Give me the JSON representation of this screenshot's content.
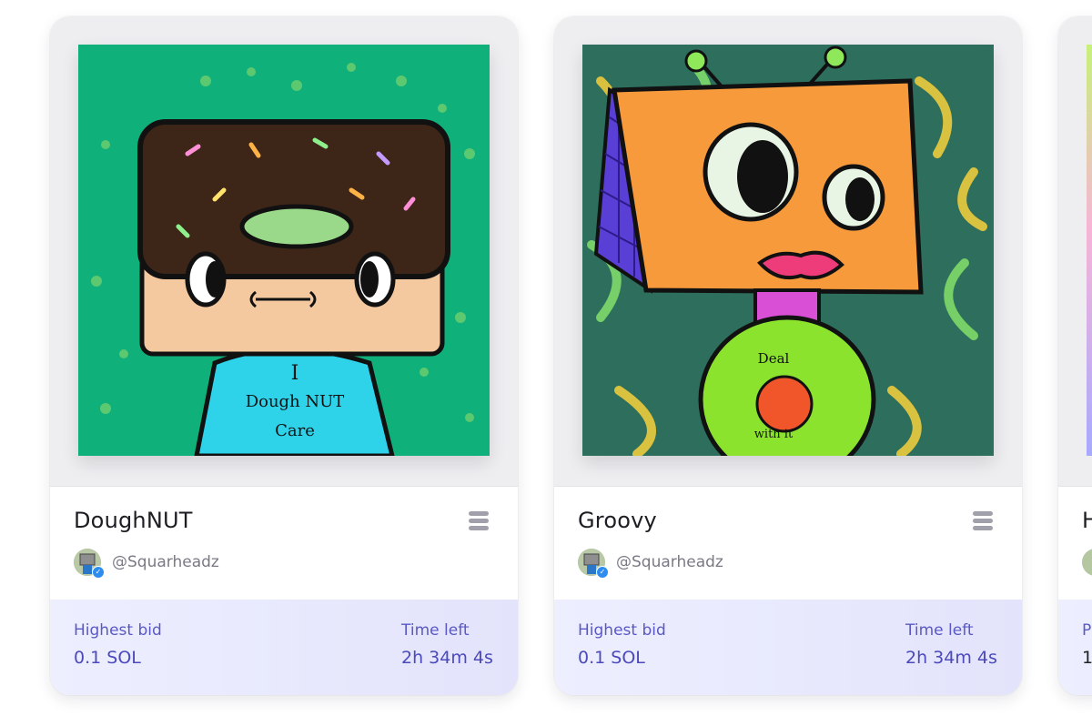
{
  "cards": [
    {
      "title": "DoughNUT",
      "creator": "@Squarheadz",
      "bid_label": "Highest bid",
      "bid_value": "0.1 SOL",
      "time_label": "Time left",
      "time_value": "2h 34m 4s",
      "art_text": [
        "I",
        "Dough NUT",
        "Care"
      ]
    },
    {
      "title": "Groovy",
      "creator": "@Squarheadz",
      "bid_label": "Highest bid",
      "bid_value": "0.1 SOL",
      "time_label": "Time left",
      "time_value": "2h 34m 4s",
      "art_text": [
        "Deal",
        "with it"
      ]
    },
    {
      "title": "H",
      "bid_label_partial": "P",
      "bid_value_partial": "1"
    }
  ],
  "colors": {
    "accent": "#5a58c4",
    "panel": "#e9eaff",
    "verified": "#2d8cf0"
  },
  "icons": {
    "menu": "hamburger-menu-icon",
    "verified": "verified-check-icon"
  }
}
